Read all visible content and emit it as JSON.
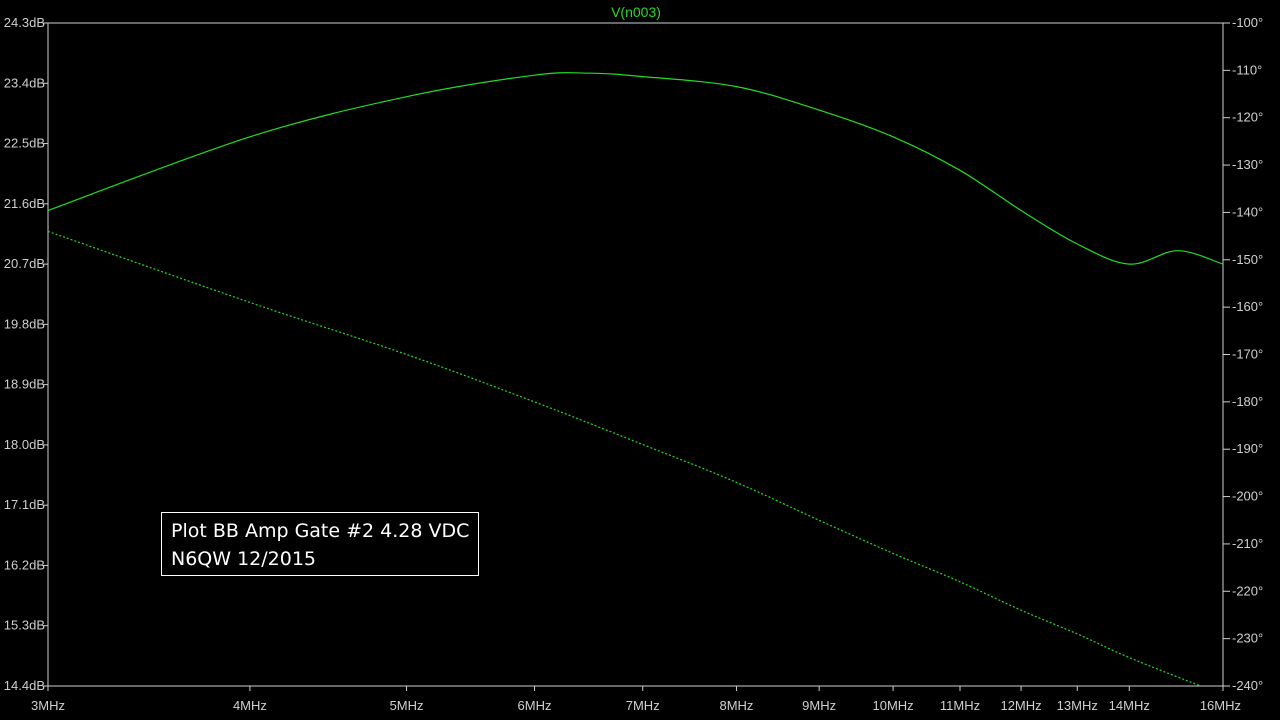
{
  "chart_data": {
    "type": "line",
    "title": "V(n003)",
    "xlabel": "",
    "ylabel_left": "",
    "ylabel_right": "",
    "x_scale": "log",
    "xlim": [
      3,
      16
    ],
    "x_unit": "MHz",
    "x_ticks": [
      "3MHz",
      "4MHz",
      "5MHz",
      "6MHz",
      "7MHz",
      "8MHz",
      "9MHz",
      "10MHz",
      "11MHz",
      "12MHz",
      "13MHz",
      "14MHz",
      "16MHz"
    ],
    "x_tick_values": [
      3,
      4,
      5,
      6,
      7,
      8,
      9,
      10,
      11,
      12,
      13,
      14,
      16
    ],
    "ylim_left": [
      14.4,
      24.3
    ],
    "y_ticks_left": [
      "24.3dB",
      "23.4dB",
      "22.5dB",
      "21.6dB",
      "20.7dB",
      "19.8dB",
      "18.9dB",
      "18.0dB",
      "17.1dB",
      "16.2dB",
      "15.3dB",
      "14.4dB"
    ],
    "y_tick_values_left": [
      24.3,
      23.4,
      22.5,
      21.6,
      20.7,
      19.8,
      18.9,
      18.0,
      17.1,
      16.2,
      15.3,
      14.4
    ],
    "ylim_right": [
      -240,
      -100
    ],
    "y_ticks_right": [
      "-100°",
      "-110°",
      "-120°",
      "-130°",
      "-140°",
      "-150°",
      "-160°",
      "-170°",
      "-180°",
      "-190°",
      "-200°",
      "-210°",
      "-220°",
      "-230°",
      "-240°"
    ],
    "y_tick_values_right": [
      -100,
      -110,
      -120,
      -130,
      -140,
      -150,
      -160,
      -170,
      -180,
      -190,
      -200,
      -210,
      -220,
      -230,
      -240
    ],
    "grid": false,
    "series": [
      {
        "name": "V(n003)",
        "quantity": "magnitude",
        "axis": "left",
        "style": "solid",
        "color": "#22dd22",
        "x": [
          3,
          4,
          5,
          6,
          6.5,
          7,
          8,
          9,
          10,
          11,
          12,
          13,
          14,
          15,
          16
        ],
        "y": [
          21.5,
          22.6,
          23.2,
          23.52,
          23.55,
          23.5,
          23.35,
          23.0,
          22.6,
          22.1,
          21.5,
          21.0,
          20.7,
          20.9,
          20.7
        ]
      },
      {
        "name": "V(n003)",
        "quantity": "phase",
        "axis": "right",
        "style": "dotted",
        "color": "#22dd22",
        "x": [
          3,
          4,
          5,
          6,
          7,
          8,
          9,
          10,
          11,
          12,
          13,
          14,
          15.5
        ],
        "y": [
          -144,
          -159,
          -170,
          -180,
          -189,
          -197,
          -205,
          -212,
          -218,
          -224,
          -229,
          -234,
          -240
        ]
      }
    ]
  },
  "annotation": {
    "line1": "Plot BB Amp Gate #2 4.28 VDC",
    "line2": "N6QW 12/2015"
  },
  "colors": {
    "background": "#000000",
    "trace": "#22dd22",
    "axes": "#cfcfcf",
    "labels": "#cfcfcf"
  }
}
